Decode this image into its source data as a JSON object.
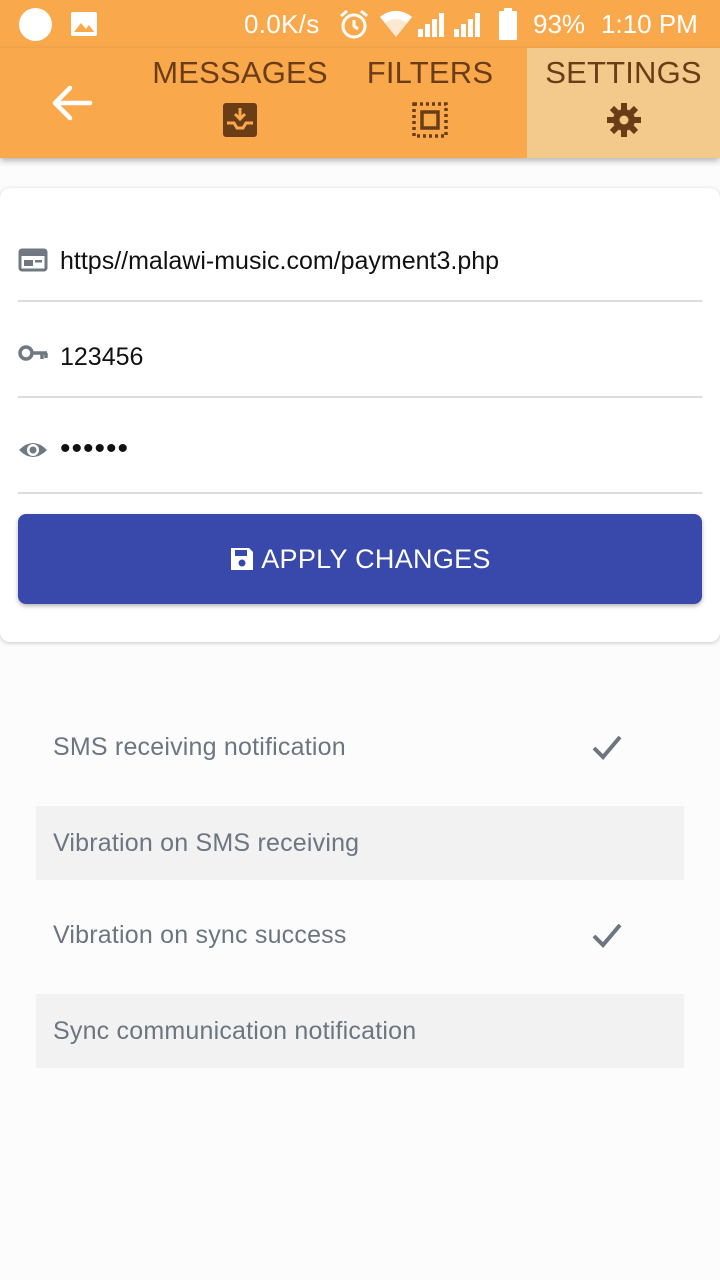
{
  "status_bar": {
    "net_speed": "0.0K/s",
    "battery": "93%",
    "time": "1:10 PM",
    "icons": [
      "notification-dot-icon",
      "image-icon",
      "alarm-icon",
      "wifi-icon",
      "signal-icon",
      "signal-icon",
      "battery-icon"
    ]
  },
  "app_bar": {
    "back_icon": "arrow-left-icon",
    "tabs": [
      {
        "label": "MESSAGES",
        "icon": "inbox-download-icon",
        "active": false
      },
      {
        "label": "FILTERS",
        "icon": "filter-select-icon",
        "active": false
      },
      {
        "label": "SETTINGS",
        "icon": "gear-icon",
        "active": true
      }
    ]
  },
  "settings_form": {
    "url": {
      "icon": "web-icon",
      "value": "https//malawi-music.com/payment3.php"
    },
    "key": {
      "icon": "key-icon",
      "value": "123456"
    },
    "password": {
      "icon": "eye-icon",
      "value": "••••••"
    },
    "apply_button": {
      "icon": "save-icon",
      "label": "APPLY CHANGES"
    }
  },
  "options": [
    {
      "label": "SMS receiving notification",
      "checked": true
    },
    {
      "label": "Vibration on SMS receiving",
      "checked": false
    },
    {
      "label": "Vibration on sync success",
      "checked": true
    },
    {
      "label": "Sync communication notification",
      "checked": false
    }
  ],
  "colors": {
    "app_bar": "#f9a94c",
    "active_tab": "#f3c98c",
    "tab_text": "#6b3d16",
    "apply_button": "#3949ab",
    "option_text": "#6d7581",
    "option_shade": "#f2f2f2"
  }
}
